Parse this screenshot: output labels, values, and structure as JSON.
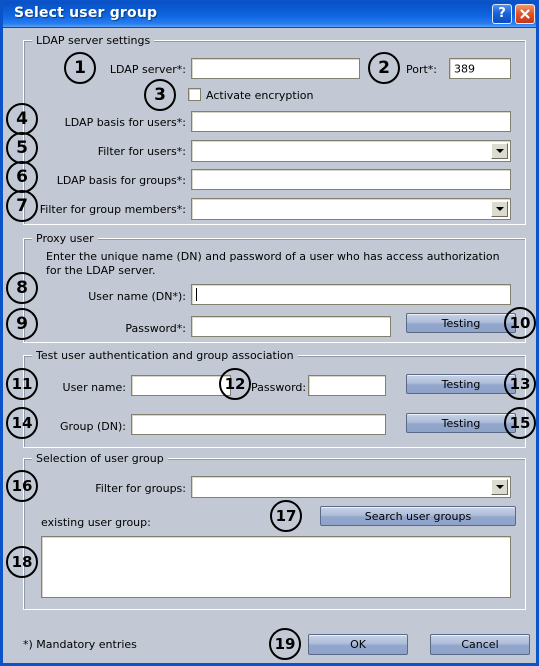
{
  "window": {
    "title": "Select user group",
    "help_button": "?",
    "close_button": "✕",
    "help_icon": "question-mark-icon",
    "close_icon": "close-x-icon"
  },
  "groups": {
    "ldap_server_settings": {
      "title": "LDAP server settings",
      "fields": {
        "ldap_server": {
          "label": "LDAP server*:",
          "value": "",
          "type": "textfield"
        },
        "port": {
          "label": "Port*:",
          "value": "389",
          "type": "textfield"
        },
        "activate_encryption": {
          "label": "Activate encryption",
          "checked": false,
          "type": "checkbox"
        },
        "ldap_basis_users": {
          "label": "LDAP basis for users*:",
          "value": "",
          "type": "textfield"
        },
        "filter_users": {
          "label": "Filter for users*:",
          "value": "",
          "type": "combobox"
        },
        "ldap_basis_groups": {
          "label": "LDAP basis for groups*:",
          "value": "",
          "type": "textfield"
        },
        "filter_group_members": {
          "label": "Filter for group members*:",
          "value": "",
          "type": "combobox"
        }
      }
    },
    "proxy_user": {
      "title": "Proxy user",
      "description": "Enter the unique name (DN) and password of a user who has access authorization for the LDAP server.",
      "fields": {
        "user_name_dn": {
          "label": "User name (DN*):",
          "value": "",
          "type": "textfield",
          "focused": true
        },
        "password": {
          "label": "Password*:",
          "value": "",
          "type": "textfield"
        }
      },
      "buttons": {
        "testing": "Testing"
      }
    },
    "test_auth": {
      "title": "Test user authentication and group association",
      "fields": {
        "user_name": {
          "label": "User name:",
          "value": "",
          "type": "textfield"
        },
        "password": {
          "label": "Password:",
          "value": "",
          "type": "textfield"
        },
        "group_dn": {
          "label": "Group (DN):",
          "value": "",
          "type": "textfield"
        }
      },
      "buttons": {
        "testing_user": "Testing",
        "testing_group": "Testing"
      }
    },
    "selection_user_group": {
      "title": "Selection of user group",
      "fields": {
        "filter_groups": {
          "label": "Filter for groups:",
          "value": "",
          "type": "combobox"
        },
        "existing_user_group": {
          "label": "existing user group:",
          "value": "",
          "type": "listbox"
        }
      },
      "buttons": {
        "search_user_groups": "Search user groups"
      }
    }
  },
  "footer": {
    "mandatory_note": "*) Mandatory entries",
    "ok": "OK",
    "cancel": "Cancel"
  },
  "callouts": [
    {
      "n": "1"
    },
    {
      "n": "2"
    },
    {
      "n": "3"
    },
    {
      "n": "4"
    },
    {
      "n": "5"
    },
    {
      "n": "6"
    },
    {
      "n": "7"
    },
    {
      "n": "8"
    },
    {
      "n": "9"
    },
    {
      "n": "10"
    },
    {
      "n": "11"
    },
    {
      "n": "12"
    },
    {
      "n": "13"
    },
    {
      "n": "14"
    },
    {
      "n": "15"
    },
    {
      "n": "16"
    },
    {
      "n": "17"
    },
    {
      "n": "18"
    },
    {
      "n": "19"
    }
  ],
  "colors": {
    "titlebar": "#0b5fd8",
    "dialog_bg": "#c3c9d4",
    "button_face": "#aebdd9",
    "field_bg": "#ffffff",
    "border": "#0a53c8"
  }
}
